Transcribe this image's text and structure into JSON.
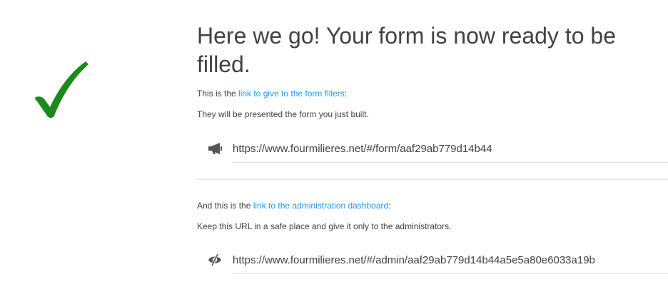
{
  "checkmark": {
    "icon": "checkmark-icon",
    "color": "#1b8a1b"
  },
  "headline": "Here we go! Your form is now ready to be\nfilled.",
  "filler": {
    "intro_prefix": "This is the ",
    "intro_link": "link to give to the form fillers",
    "intro_suffix": ":",
    "description": "They will be presented the form you just built.",
    "icon": "megaphone-icon",
    "url": "https://www.fourmilieres.net/#/form/aaf29ab779d14b44"
  },
  "admin": {
    "intro_prefix": "And this is the ",
    "intro_link": "link to the administration dashboard",
    "intro_suffix": ":",
    "description": "Keep this URL in a safe place and give it only to the administrators.",
    "icon": "eye-slash-icon",
    "url": "https://www.fourmilieres.net/#/admin/aaf29ab779d14b44a5e5a80e6033a19b"
  },
  "colors": {
    "link": "#2196f3",
    "text": "#424242",
    "check": "#1b8a1b"
  }
}
